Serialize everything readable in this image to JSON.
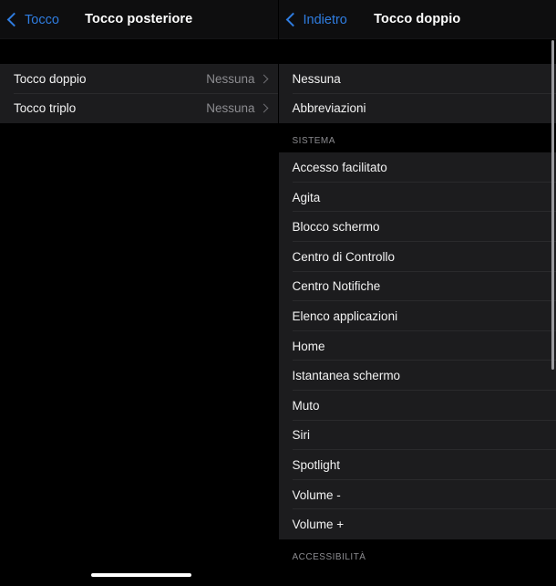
{
  "left_panel": {
    "navbar": {
      "back_label": "Tocco",
      "title": "Tocco posteriore"
    },
    "rows": [
      {
        "label": "Tocco doppio",
        "value": "Nessuna"
      },
      {
        "label": "Tocco triplo",
        "value": "Nessuna"
      }
    ]
  },
  "right_panel": {
    "navbar": {
      "back_label": "Indietro",
      "title": "Tocco doppio"
    },
    "top_rows": [
      {
        "label": "Nessuna"
      },
      {
        "label": "Abbreviazioni"
      }
    ],
    "system_section": {
      "header": "SISTEMA",
      "rows": [
        {
          "label": "Accesso facilitato"
        },
        {
          "label": "Agita"
        },
        {
          "label": "Blocco schermo"
        },
        {
          "label": "Centro di Controllo"
        },
        {
          "label": "Centro Notifiche"
        },
        {
          "label": "Elenco applicazioni"
        },
        {
          "label": "Home"
        },
        {
          "label": "Istantanea schermo"
        },
        {
          "label": "Muto"
        },
        {
          "label": "Siri"
        },
        {
          "label": "Spotlight"
        },
        {
          "label": "Volume -"
        },
        {
          "label": "Volume +"
        }
      ]
    },
    "next_section": {
      "header": "ACCESSIBILITÀ"
    }
  },
  "colors": {
    "accent": "#2f7de1",
    "row_background": "#1c1c1e",
    "page_background": "#000000",
    "separator": "#2a2a2c",
    "secondary_text": "#8c8c90"
  }
}
